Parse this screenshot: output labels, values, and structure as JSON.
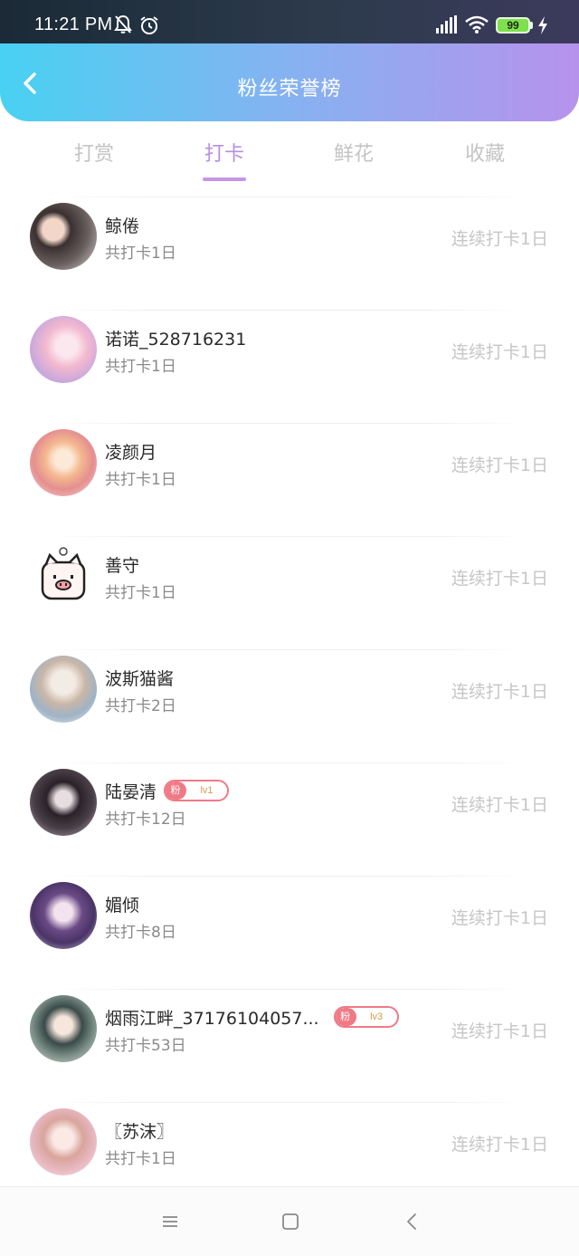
{
  "status_bar": {
    "time": "11:21 PM",
    "battery": "99",
    "icons": [
      "bell-off-icon",
      "alarm-icon",
      "hd-signal-icon",
      "wifi-icon",
      "battery-icon",
      "charging-icon"
    ]
  },
  "header": {
    "title": "粉丝荣誉榜",
    "back_icon": "chevron-left-icon"
  },
  "tabs": [
    {
      "label": "打赏",
      "active": false
    },
    {
      "label": "打卡",
      "active": true
    },
    {
      "label": "鲜花",
      "active": false
    },
    {
      "label": "收藏",
      "active": false
    }
  ],
  "list": [
    {
      "name": "鲸倦",
      "total": "共打卡1日",
      "streak": "连续打卡1日",
      "badge": null
    },
    {
      "name": "诺诺_528716231",
      "total": "共打卡1日",
      "streak": "连续打卡1日",
      "badge": null
    },
    {
      "name": "凌颜月",
      "total": "共打卡1日",
      "streak": "连续打卡1日",
      "badge": null
    },
    {
      "name": "善守",
      "total": "共打卡1日",
      "streak": "连续打卡1日",
      "badge": null
    },
    {
      "name": "波斯猫酱",
      "total": "共打卡2日",
      "streak": "连续打卡1日",
      "badge": null
    },
    {
      "name": "陆晏清",
      "total": "共打卡12日",
      "streak": "连续打卡1日",
      "badge": {
        "fan": "粉",
        "level": "lv1"
      }
    },
    {
      "name": "媚倾",
      "total": "共打卡8日",
      "streak": "连续打卡1日",
      "badge": null
    },
    {
      "name": "烟雨江畔_37176104057...",
      "total": "共打卡53日",
      "streak": "连续打卡1日",
      "badge": {
        "fan": "粉",
        "level": "lv3"
      }
    },
    {
      "name": "〖苏沫〗",
      "total": "共打卡1日",
      "streak": "连续打卡1日",
      "badge": null
    }
  ],
  "colors": {
    "header_gradient_start": "#48d1f2",
    "header_gradient_end": "#b792ec",
    "active_tab": "#b88fe0",
    "badge": "#ef7a86"
  },
  "nav_bar": {
    "icons": [
      "menu-icon",
      "home-square-icon",
      "back-triangle-icon"
    ]
  }
}
